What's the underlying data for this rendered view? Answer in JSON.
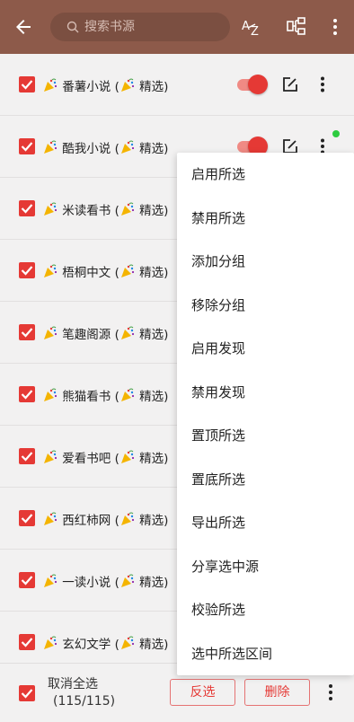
{
  "header": {
    "search_placeholder": "搜索书源",
    "icons": {
      "back": "arrow-left-icon",
      "sort": "sort-az-icon",
      "group": "group-icon",
      "more": "more-vert-icon"
    },
    "colors": {
      "bar": "#8d5a4a",
      "accent": "#e53935"
    }
  },
  "sources": [
    {
      "label": "番薯小说",
      "suffix": "精选",
      "enabled": true
    },
    {
      "label": "酷我小说",
      "suffix": "精选",
      "enabled": true
    },
    {
      "label": "米读看书",
      "suffix": "精选"
    },
    {
      "label": "梧桐中文",
      "suffix": "精选"
    },
    {
      "label": "笔趣阁源",
      "suffix": "精选"
    },
    {
      "label": "熊猫看书",
      "suffix": "精选"
    },
    {
      "label": "爱看书吧",
      "suffix": "精选"
    },
    {
      "label": "西红柿网",
      "suffix": "精选"
    },
    {
      "label": "一读小说",
      "suffix": "精选"
    },
    {
      "label": "玄幻文学",
      "suffix": "精选"
    }
  ],
  "menu": {
    "items": [
      "启用所选",
      "禁用所选",
      "添加分组",
      "移除分组",
      "启用发现",
      "禁用发现",
      "置顶所选",
      "置底所选",
      "导出所选",
      "分享选中源",
      "校验所选",
      "选中所选区间"
    ]
  },
  "bottom": {
    "cancel_all": "取消全选",
    "count": "(115/115)",
    "invert_label": "反选",
    "delete_label": "删除"
  }
}
